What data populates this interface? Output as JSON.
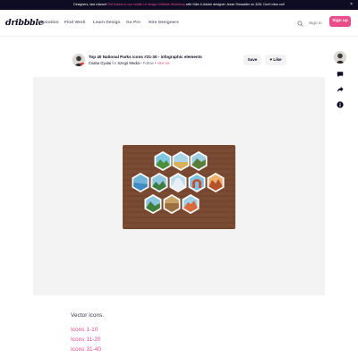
{
  "banner": {
    "lead": "Designers, last chance!",
    "highlight": "Get tickets to our mobile UI design Dribbble Workshop",
    "tail": "with Nike & Adobe designer Jesse Showalter on 3/26. Don't miss out!",
    "close_icon": "close-icon"
  },
  "nav": {
    "logo": "dribbble",
    "links": [
      "Inspiration",
      "Find Work",
      "Learn Design",
      "Go Pro",
      "Hire Designers"
    ],
    "signin": "Sign in",
    "signup": "Sign up",
    "accent": "#ea4c89"
  },
  "shot": {
    "title": "Top 40 National Parks icons #21-30 - infographic elements",
    "author": "Csaba Gyulai",
    "for_text": "for",
    "team": "Szegó Media",
    "follow": "Follow",
    "separator": "•",
    "hire": "Hire Us",
    "save": "Save",
    "like": "Like",
    "like_icon": "heart-icon"
  },
  "rail": {
    "icons": [
      "avatar",
      "comment-icon",
      "share-icon",
      "info-icon"
    ]
  },
  "description": {
    "text": "Vector icons.",
    "links": [
      "Icons 1-10",
      "Icons 11-20",
      "Icons 31-40"
    ]
  }
}
